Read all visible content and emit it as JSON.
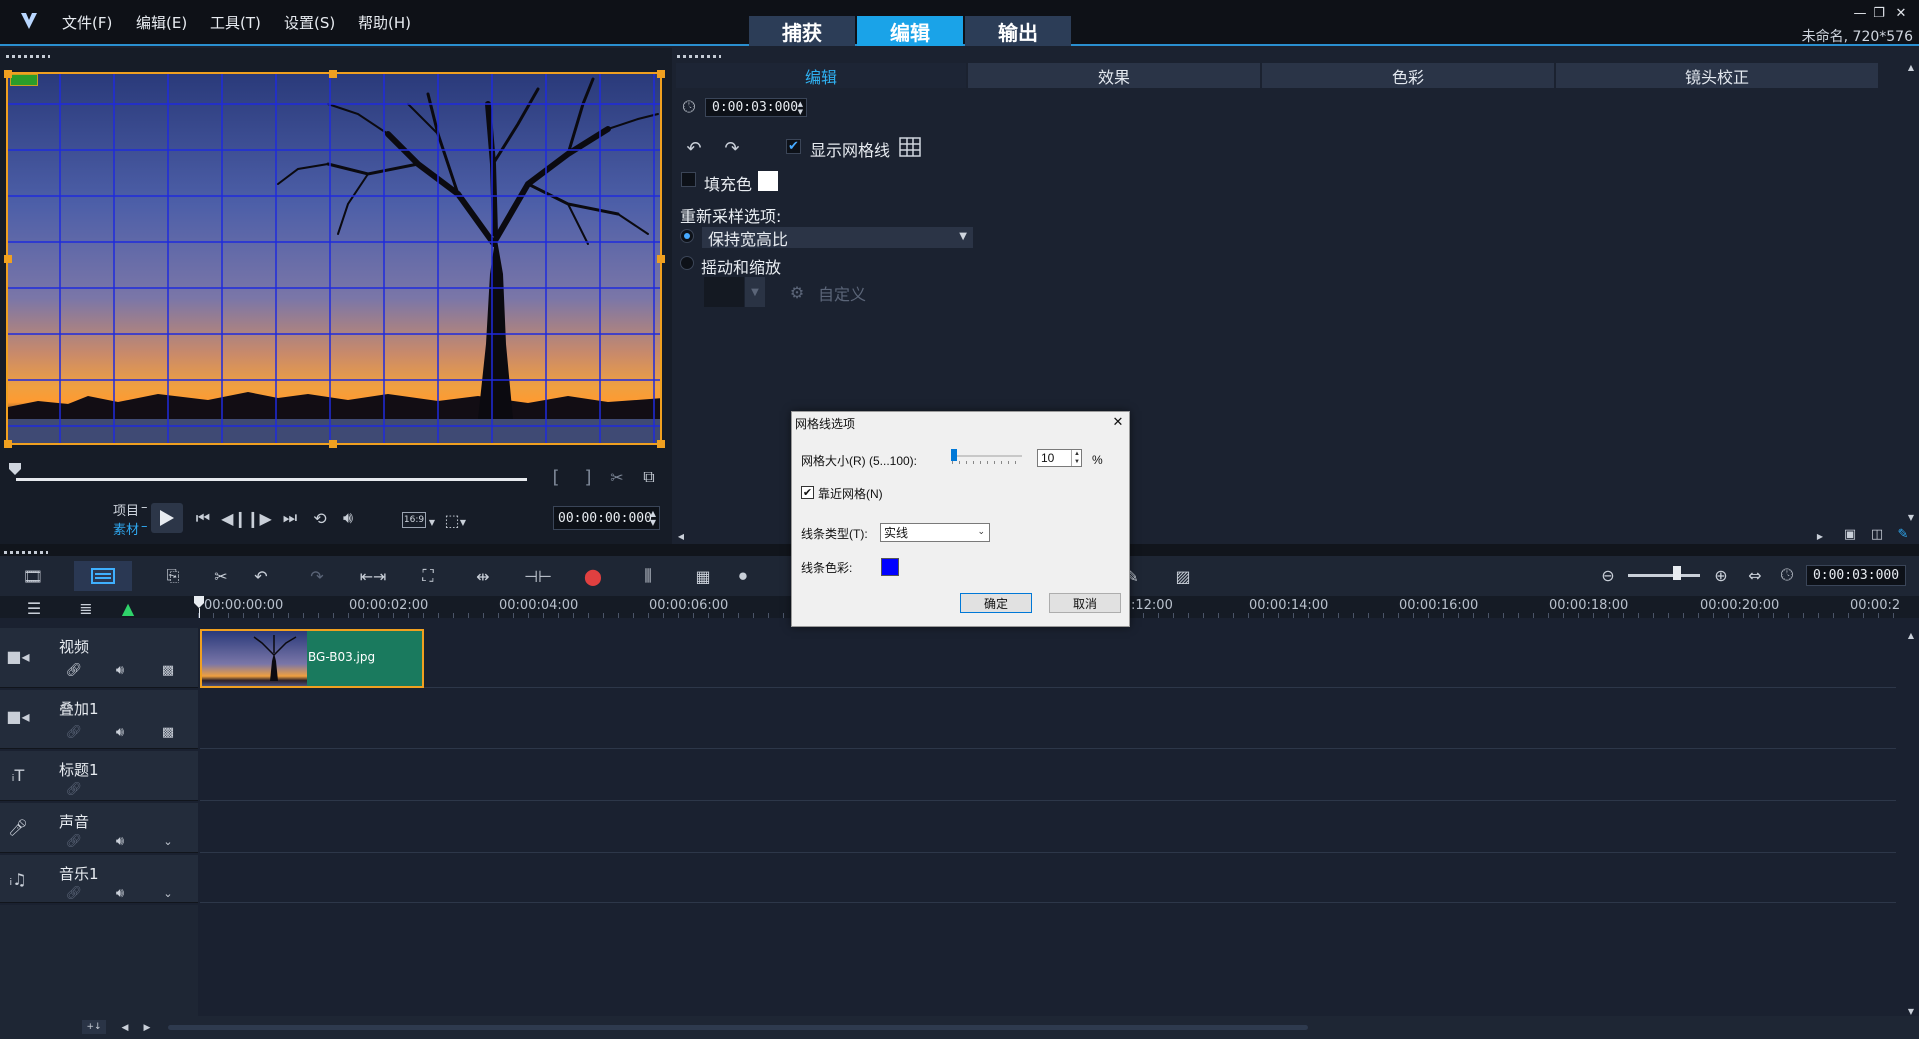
{
  "menu": [
    "文件(F)",
    "编辑(E)",
    "工具(T)",
    "设置(S)",
    "帮助(H)"
  ],
  "workspace_tabs": [
    "捕获",
    "编辑",
    "输出"
  ],
  "project_info": "未命名, 720*576",
  "preview": {
    "project_label": "项目",
    "clip_label": "素材",
    "timecode": "00:00:00:000",
    "aspect": "16:9"
  },
  "options": {
    "tabs": [
      "编辑",
      "效果",
      "色彩",
      "镜头校正"
    ],
    "duration": "0:00:03:000",
    "show_grid_label": "显示网格线",
    "fill_color_label": "填充色",
    "resample_label": "重新采样选项:",
    "resample_value": "保持宽高比",
    "pan_zoom_label": "摇动和缩放",
    "custom_label": "自定义"
  },
  "timeline": {
    "duration": "0:00:03:000",
    "ticks": [
      "00:00:00:00",
      "00:00:02:00",
      "00:00:04:00",
      "00:00:06:00",
      ":12:00",
      "00:00:14:00",
      "00:00:16:00",
      "00:00:18:00",
      "00:00:20:00",
      "00:00:2"
    ],
    "tracks": [
      "视频",
      "叠加1",
      "标题1",
      "声音",
      "音乐1"
    ],
    "clip_name": "BG-B03.jpg"
  },
  "dialog": {
    "title": "网格线选项",
    "size_label": "网格大小(R) (5...100):",
    "size_value": "10",
    "size_unit": "%",
    "snap_label": "靠近网格(N)",
    "line_type_label": "线条类型(T):",
    "line_type_value": "实线",
    "line_color_label": "线条色彩:",
    "line_color": "#0000ff",
    "ok": "确定",
    "cancel": "取消"
  },
  "colors": {
    "accent": "#1aa3e8",
    "clip": "#1a7a5e",
    "grid": "#1f2bdc",
    "crop_frame": "#f0a020"
  }
}
